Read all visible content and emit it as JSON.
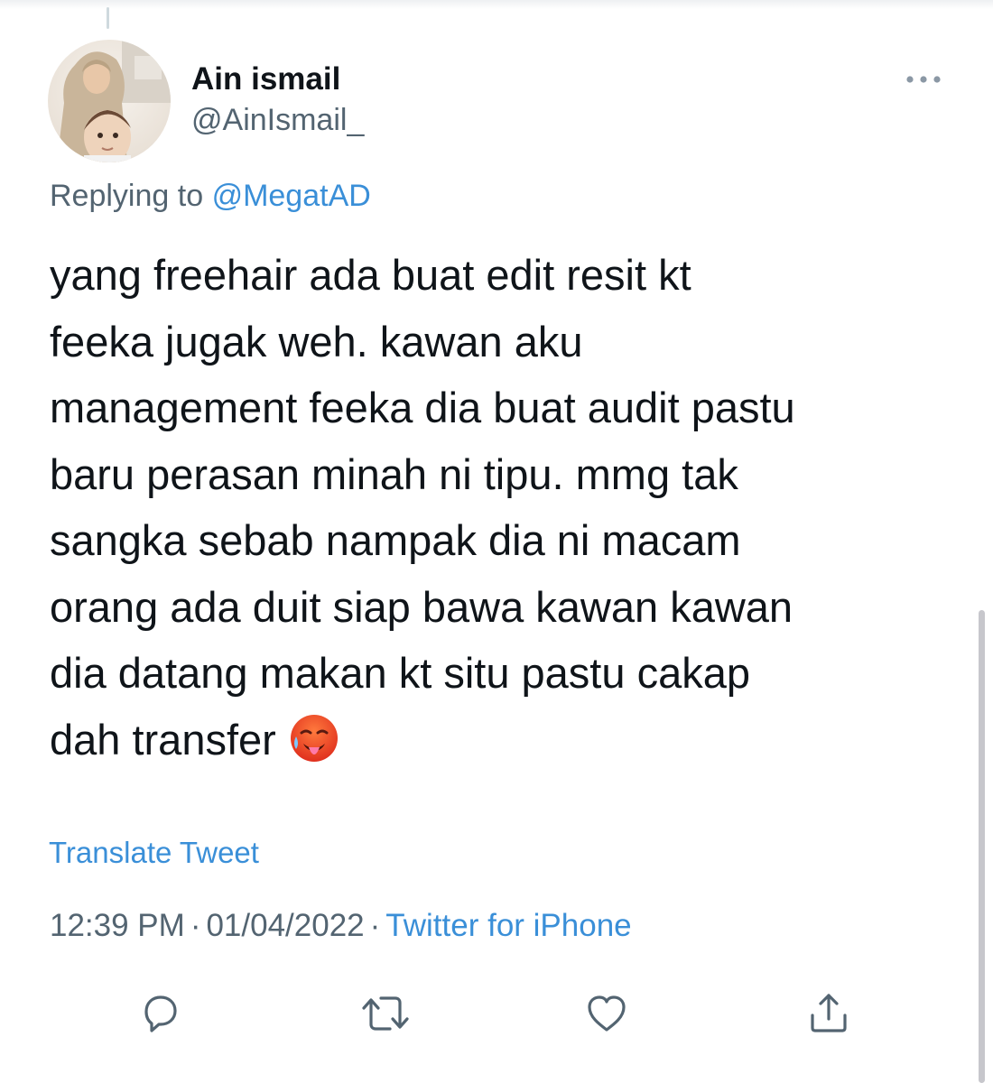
{
  "tweet": {
    "author": {
      "display_name": "Ain ismail",
      "handle": "@AinIsmail_"
    },
    "replying_prefix": "Replying to",
    "replying_to": "@MegatAD",
    "text_lines": [
      "yang freehair ada buat edit resit kt",
      "feeka jugak weh. kawan aku",
      "management feeka dia buat audit pastu",
      "baru perasan minah ni tipu. mmg tak",
      "sangka sebab nampak dia ni macam",
      "orang ada duit siap bawa kawan kawan",
      "dia datang makan kt situ pastu cakap",
      "dah transfer"
    ],
    "emoji": "hot-face-emoji",
    "translate_label": "Translate Tweet",
    "time": "12:39 PM",
    "separator": "·",
    "date": "01/04/2022",
    "source": "Twitter for iPhone",
    "actions": [
      "reply-icon",
      "retweet-icon",
      "like-icon",
      "share-icon"
    ]
  },
  "colors": {
    "text_primary": "#0f1419",
    "text_secondary": "#536471",
    "link": "#3a8fd8",
    "icon": "#536471"
  }
}
